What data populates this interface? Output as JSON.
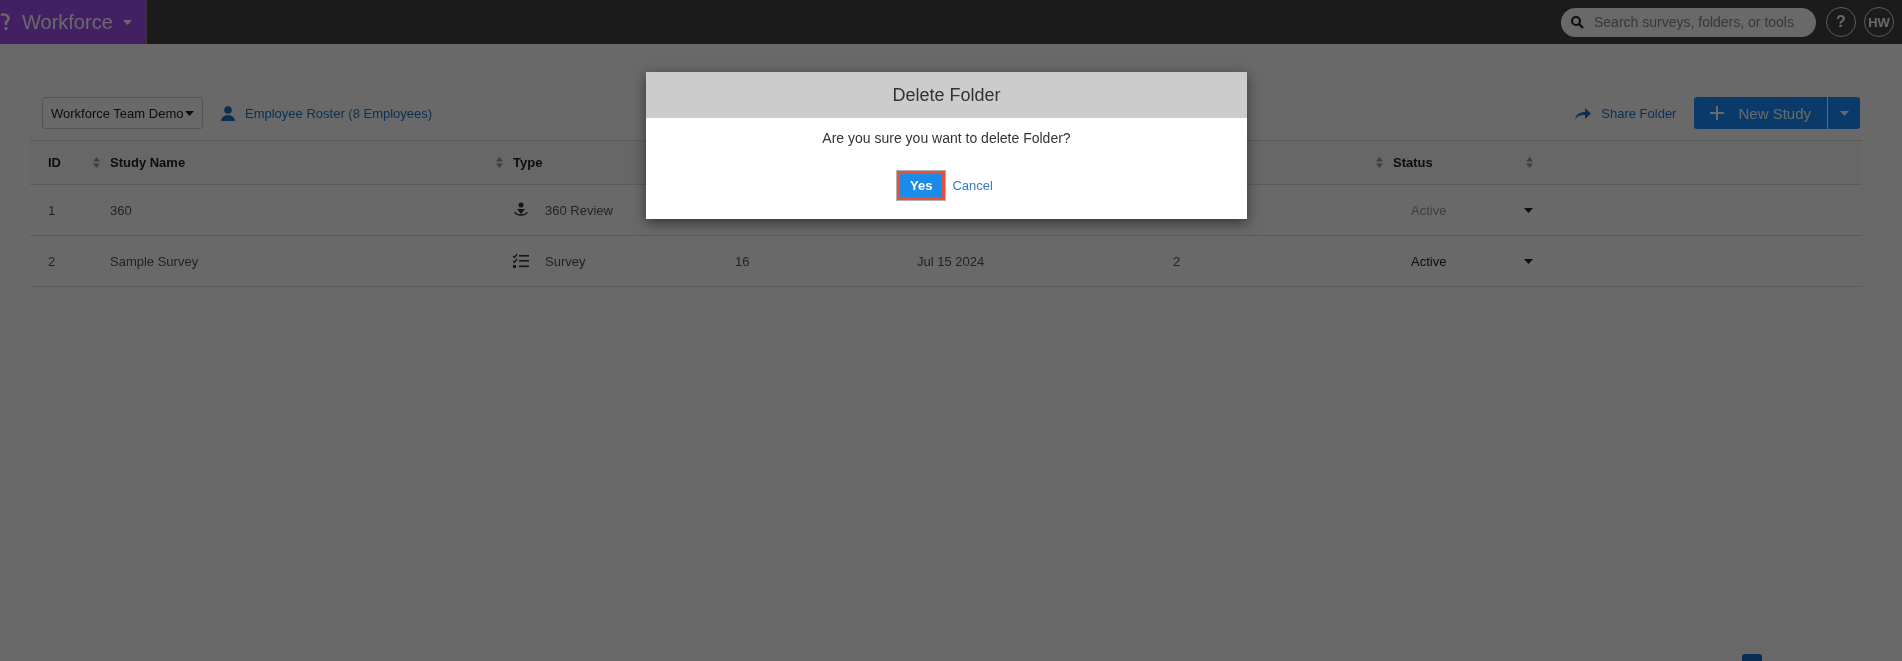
{
  "top_bar": {
    "app_name": "Workforce",
    "search": {
      "placeholder": "Search surveys, folders, or tools"
    },
    "help": "?",
    "avatar": "HW"
  },
  "toolbar": {
    "team_select": "Workforce Team Demo",
    "roster_link": "Employee Roster (8 Employees)",
    "share_link": "Share Folder",
    "new_study_button": "New Study"
  },
  "table": {
    "columns": [
      {
        "label": "ID",
        "sortable": true
      },
      {
        "label": "Study Name",
        "sortable": true
      },
      {
        "label": "Type"
      },
      {},
      {},
      {
        "sortable": true
      },
      {
        "label": "Status",
        "sortable": true
      }
    ],
    "rows": [
      {
        "id": "1",
        "name": "360",
        "type": "360 Review",
        "kind": "review",
        "status": "Active",
        "disabled": true
      },
      {
        "id": "2",
        "name": "Sample Survey",
        "type": "Survey",
        "kind": "survey",
        "column_4": "16",
        "column_5": "Jul 15 2024",
        "column_6": "2",
        "status": "Active",
        "disabled": false
      }
    ]
  },
  "dialog": {
    "title": "Delete Folder",
    "message": "Are you sure you want to delete Folder?",
    "buttons": [
      {
        "label": "Yes",
        "kind": "primary",
        "focused": true
      },
      {
        "label": "Cancel",
        "kind": "link",
        "focused": false
      }
    ]
  }
}
